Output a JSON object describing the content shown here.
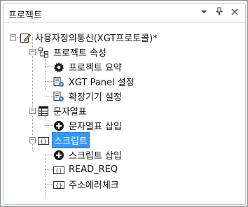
{
  "panel": {
    "title": "프로젝트",
    "dropdown_icon": "chevron-down-icon",
    "pin_icon": "pin-icon",
    "close_icon": "close-icon"
  },
  "tree": {
    "root": {
      "label": "사용자정의통신(XGT프로토콜)*",
      "expanded": true
    },
    "project_settings": {
      "label": "프로젝트 속성",
      "expanded": true
    },
    "project_summary": {
      "label": "프로젝트 요약"
    },
    "xgt_panel_settings": {
      "label": "XGT Panel 설정"
    },
    "expansion_settings": {
      "label": "확장기기 설정"
    },
    "string_table": {
      "label": "문자열표",
      "expanded": true
    },
    "insert_string_table": {
      "label": "문자열표 삽입"
    },
    "script": {
      "label": "스크립트",
      "expanded": true,
      "selected": true
    },
    "insert_script": {
      "label": "스크립트 삽입"
    },
    "read_req": {
      "label": "READ_REQ"
    },
    "address_error_check": {
      "label": "주소에러체크"
    }
  },
  "colors": {
    "selection": "#3399ff",
    "border": "#b8c4d6"
  }
}
